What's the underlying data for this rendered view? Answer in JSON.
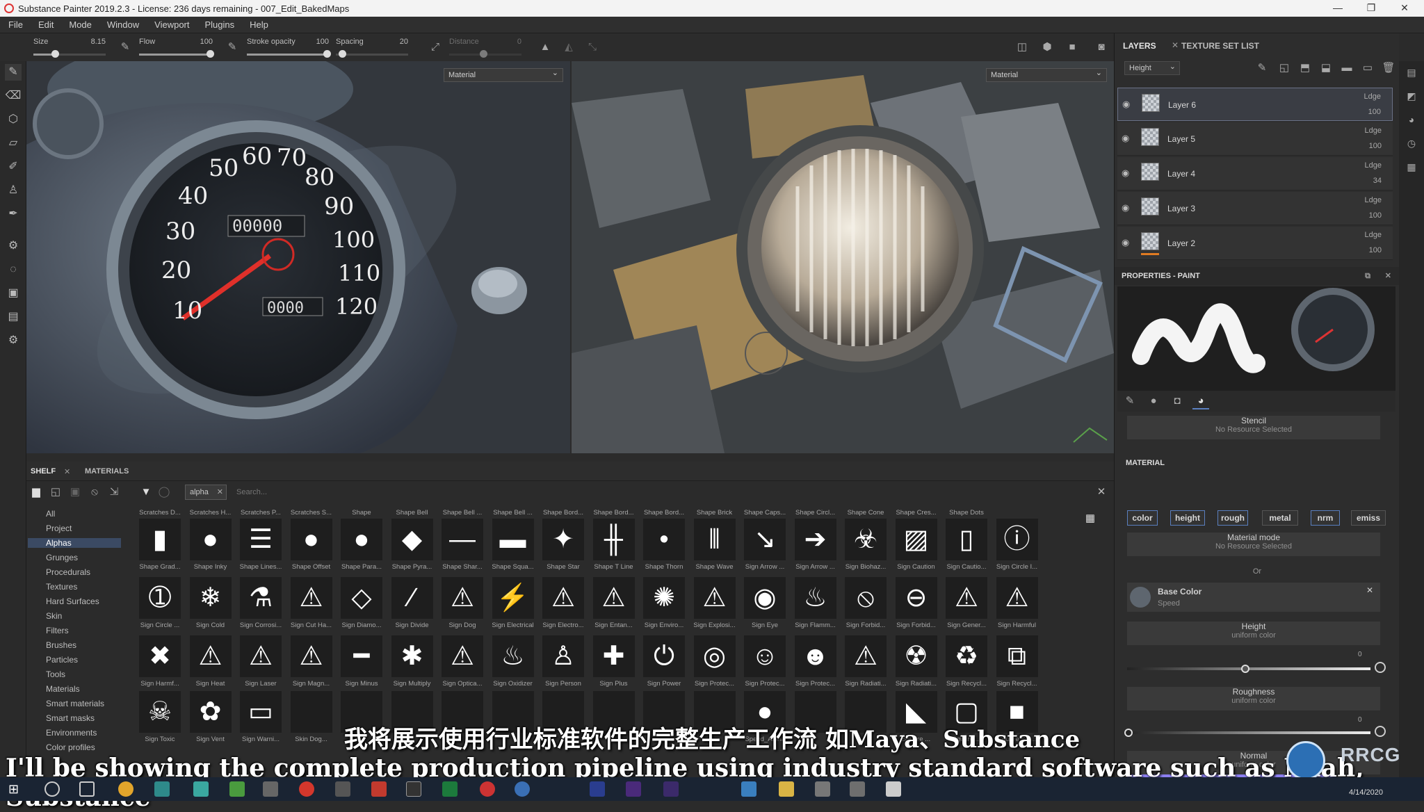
{
  "titlebar": {
    "title": "Substance Painter 2019.2.3 - License: 236 days remaining - 007_Edit_BakedMaps"
  },
  "menu": [
    "File",
    "Edit",
    "Mode",
    "Window",
    "Viewport",
    "Plugins",
    "Help"
  ],
  "toolbar": {
    "size_label": "Size",
    "size_value": "8.15",
    "flow_label": "Flow",
    "flow_value": "100",
    "stroke_label": "Stroke opacity",
    "stroke_value": "100",
    "spacing_label": "Spacing",
    "spacing_value": "20",
    "distance_label": "Distance",
    "distance_value": "0"
  },
  "viewports": {
    "left_mode": "Material",
    "right_mode": "Material",
    "speedo_numbers": [
      "10",
      "20",
      "30",
      "40",
      "50",
      "60",
      "70",
      "80",
      "90",
      "100",
      "110",
      "120"
    ],
    "odometer": "00000",
    "trip": "0000"
  },
  "layers": {
    "tab_label": "LAYERS",
    "tab2_label": "TEXTURE SET LIST",
    "channel": "Height",
    "items": [
      {
        "name": "Layer 6",
        "blend": "Ldge",
        "opacity": "100"
      },
      {
        "name": "Layer 5",
        "blend": "Ldge",
        "opacity": "100"
      },
      {
        "name": "Layer 4",
        "blend": "Ldge",
        "opacity": "34"
      },
      {
        "name": "Layer 3",
        "blend": "Ldge",
        "opacity": "100"
      },
      {
        "name": "Layer 2",
        "blend": "Ldge",
        "opacity": "100"
      }
    ]
  },
  "properties": {
    "title": "PROPERTIES - PAINT",
    "stencil": "Stencil",
    "stencil_sub": "No Resource Selected",
    "material_label": "MATERIAL",
    "channels": [
      "color",
      "height",
      "rough",
      "metal",
      "nrm",
      "emiss"
    ],
    "material_mode": "Material mode",
    "material_mode_sub": "No Resource Selected",
    "or": "Or",
    "base_color": "Base Color",
    "base_color_sub": "Speed",
    "height": "Height",
    "height_sub": "uniform color",
    "height_val": "0",
    "roughness": "Roughness",
    "roughness_sub": "uniform color",
    "roughness_val": "0",
    "normal": "Normal",
    "normal_sub": "uniform color"
  },
  "shelf": {
    "tab_label": "SHELF",
    "tab2_label": "MATERIALS",
    "filter_tag": "alpha",
    "search_placeholder": "Search...",
    "categories": [
      "All",
      "Project",
      "Alphas",
      "Grunges",
      "Procedurals",
      "Textures",
      "Hard Surfaces",
      "Skin",
      "Filters",
      "Brushes",
      "Particles",
      "Tools",
      "Materials",
      "Smart materials",
      "Smart masks",
      "Environments",
      "Color profiles"
    ],
    "selected_category": "Alphas",
    "rows": [
      [
        {
          "t": "Scratches D...",
          "i": ""
        },
        {
          "t": "Scratches H...",
          "i": ""
        },
        {
          "t": "Scratches P...",
          "i": ""
        },
        {
          "t": "Scratches S...",
          "i": ""
        },
        {
          "t": "Shape",
          "i": ""
        },
        {
          "t": "Shape Bell",
          "i": ""
        },
        {
          "t": "Shape Bell ...",
          "i": ""
        },
        {
          "t": "Shape Bell ...",
          "i": ""
        },
        {
          "t": "Shape Bord...",
          "i": ""
        },
        {
          "t": "Shape Bord...",
          "i": ""
        },
        {
          "t": "Shape Bord...",
          "i": ""
        },
        {
          "t": "Shape Brick",
          "i": ""
        },
        {
          "t": "Shape Caps...",
          "i": ""
        },
        {
          "t": "Shape Circl...",
          "i": ""
        },
        {
          "t": "Shape Cone",
          "i": ""
        },
        {
          "t": "Shape Cres...",
          "i": ""
        },
        {
          "t": "Shape Dots",
          "i": ""
        }
      ],
      [
        {
          "t": "Shape Grad...",
          "i": "▮"
        },
        {
          "t": "Shape Inky",
          "i": "●"
        },
        {
          "t": "Shape Lines...",
          "i": "☰"
        },
        {
          "t": "Shape Offset",
          "i": "●"
        },
        {
          "t": "Shape Para...",
          "i": "●"
        },
        {
          "t": "Shape Pyra...",
          "i": "◆"
        },
        {
          "t": "Shape Shar...",
          "i": "—"
        },
        {
          "t": "Shape Squa...",
          "i": "▬"
        },
        {
          "t": "Shape Star",
          "i": "✦"
        },
        {
          "t": "Shape T Line",
          "i": "╫"
        },
        {
          "t": "Shape Thorn",
          "i": "•"
        },
        {
          "t": "Shape Wave",
          "i": "⦀"
        },
        {
          "t": "Sign Arrow ...",
          "i": "↘"
        },
        {
          "t": "Sign Arrow ...",
          "i": "➔"
        },
        {
          "t": "Sign Biohaz...",
          "i": "☣"
        },
        {
          "t": "Sign Caution",
          "i": "▨"
        },
        {
          "t": "Sign Cautio...",
          "i": "▯"
        },
        {
          "t": "Sign Circle I...",
          "i": "ⓘ"
        }
      ],
      [
        {
          "t": "Sign Circle ...",
          "i": "➀"
        },
        {
          "t": "Sign Cold",
          "i": "❄"
        },
        {
          "t": "Sign Corrosi...",
          "i": "⚗"
        },
        {
          "t": "Sign Cut Ha...",
          "i": "⚠"
        },
        {
          "t": "Sign Diamo...",
          "i": "◇"
        },
        {
          "t": "Sign Divide",
          "i": "∕"
        },
        {
          "t": "Sign Dog",
          "i": "⚠"
        },
        {
          "t": "Sign Electrical",
          "i": "⚡"
        },
        {
          "t": "Sign Electro...",
          "i": "⚠"
        },
        {
          "t": "Sign Entan...",
          "i": "⚠"
        },
        {
          "t": "Sign Enviro...",
          "i": "✺"
        },
        {
          "t": "Sign Explosi...",
          "i": "⚠"
        },
        {
          "t": "Sign Eye",
          "i": "◉"
        },
        {
          "t": "Sign Flamm...",
          "i": "♨"
        },
        {
          "t": "Sign Forbid...",
          "i": "⦸"
        },
        {
          "t": "Sign Forbid...",
          "i": "⊖"
        },
        {
          "t": "Sign Gener...",
          "i": "⚠"
        },
        {
          "t": "Sign Harmful",
          "i": "⚠"
        }
      ],
      [
        {
          "t": "Sign Harmf...",
          "i": "✖"
        },
        {
          "t": "Sign Heat",
          "i": "⚠"
        },
        {
          "t": "Sign Laser",
          "i": "⚠"
        },
        {
          "t": "Sign Magn...",
          "i": "⚠"
        },
        {
          "t": "Sign Minus",
          "i": "━"
        },
        {
          "t": "Sign Multiply",
          "i": "✱"
        },
        {
          "t": "Sign Optica...",
          "i": "⚠"
        },
        {
          "t": "Sign Oxidizer",
          "i": "♨"
        },
        {
          "t": "Sign Person",
          "i": "♙"
        },
        {
          "t": "Sign Plus",
          "i": "✚"
        },
        {
          "t": "Sign Power",
          "i": "⏻"
        },
        {
          "t": "Sign Protec...",
          "i": "◎"
        },
        {
          "t": "Sign Protec...",
          "i": "☺"
        },
        {
          "t": "Sign Protec...",
          "i": "☻"
        },
        {
          "t": "Sign Radiati...",
          "i": "⚠"
        },
        {
          "t": "Sign Radiati...",
          "i": "☢"
        },
        {
          "t": "Sign Recycl...",
          "i": "♻"
        },
        {
          "t": "Sign Recycl...",
          "i": "⧉"
        }
      ],
      [
        {
          "t": "Sign Toxic",
          "i": "☠"
        },
        {
          "t": "Sign Vent",
          "i": "✿"
        },
        {
          "t": "Sign Warni...",
          "i": "▭"
        },
        {
          "t": "Skin Dog...",
          "i": ""
        },
        {
          "t": "",
          "i": ""
        },
        {
          "t": "",
          "i": ""
        },
        {
          "t": "",
          "i": ""
        },
        {
          "t": "",
          "i": ""
        },
        {
          "t": "",
          "i": ""
        },
        {
          "t": "",
          "i": ""
        },
        {
          "t": "",
          "i": ""
        },
        {
          "t": "",
          "i": ""
        },
        {
          "t": "Speed_Alpha",
          "i": "●"
        },
        {
          "t": "",
          "i": ""
        },
        {
          "t": "",
          "i": ""
        },
        {
          "t": "Square ...",
          "i": "◣"
        },
        {
          "t": "Square ...",
          "i": "▢"
        },
        {
          "t": "Square Sol...",
          "i": "■"
        }
      ]
    ]
  },
  "subtitles": {
    "cn": "我将展示使用行业标准软件的完整生产工作流 如Maya、Substance",
    "en": "I'll be showing the complete production pipeline using industry standard software such as Miah, Substance"
  },
  "watermark": "RRCG",
  "clock": {
    "date": "4/14/2020"
  }
}
